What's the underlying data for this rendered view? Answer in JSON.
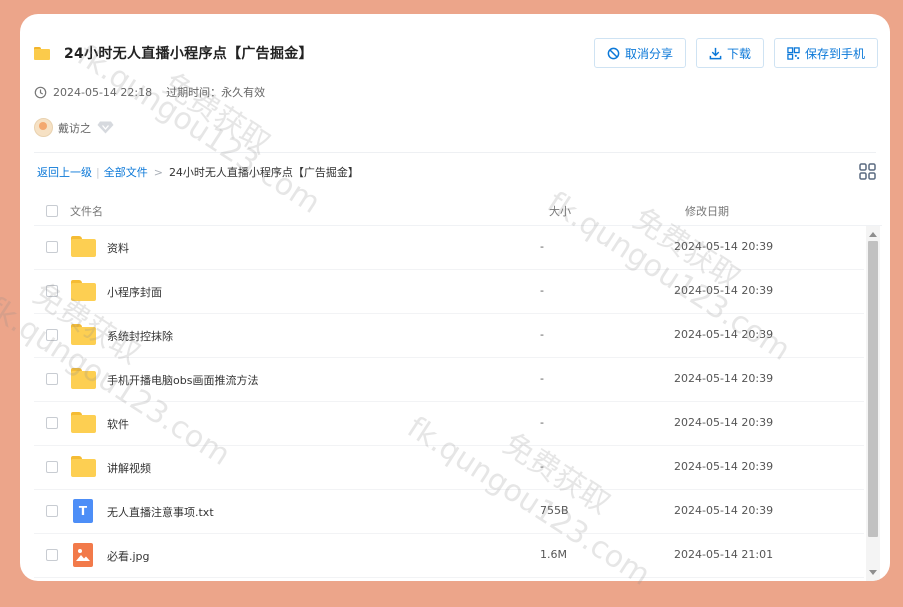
{
  "share": {
    "title": "24小时无人直播小程序点【广告掘金】",
    "date": "2024-05-14 22:18",
    "expire_label": "过期时间：永久有效",
    "user": "戴访之"
  },
  "actions": {
    "cancel_share": "取消分享",
    "download": "下载",
    "save_to_phone": "保存到手机"
  },
  "breadcrumb": {
    "back": "返回上一级",
    "sep": "|",
    "all_files": "全部文件",
    "arrow": ">",
    "current": "24小时无人直播小程序点【广告掘金】"
  },
  "table": {
    "headers": {
      "name": "文件名",
      "size": "大小",
      "modified": "修改日期"
    },
    "rows": [
      {
        "name": "资料",
        "size": "-",
        "date": "2024-05-14 20:39",
        "type": "folder"
      },
      {
        "name": "小程序封面",
        "size": "-",
        "date": "2024-05-14 20:39",
        "type": "folder"
      },
      {
        "name": "系统封控抹除",
        "size": "-",
        "date": "2024-05-14 20:39",
        "type": "folder"
      },
      {
        "name": "手机开播电脑obs画面推流方法",
        "size": "-",
        "date": "2024-05-14 20:39",
        "type": "folder"
      },
      {
        "name": "软件",
        "size": "-",
        "date": "2024-05-14 20:39",
        "type": "folder"
      },
      {
        "name": "讲解视频",
        "size": "-",
        "date": "2024-05-14 20:39",
        "type": "folder"
      },
      {
        "name": "无人直播注意事项.txt",
        "size": "755B",
        "date": "2024-05-14 20:39",
        "type": "txt"
      },
      {
        "name": "必看.jpg",
        "size": "1.6M",
        "date": "2024-05-14 21:01",
        "type": "jpg"
      }
    ]
  },
  "doc_letter": "T",
  "watermarks": [
    "fk.qungou123.com",
    "免费获取"
  ],
  "colors": {
    "background": "#ECA58A",
    "accent": "#0B78D8",
    "folder": "#FDCF52"
  }
}
